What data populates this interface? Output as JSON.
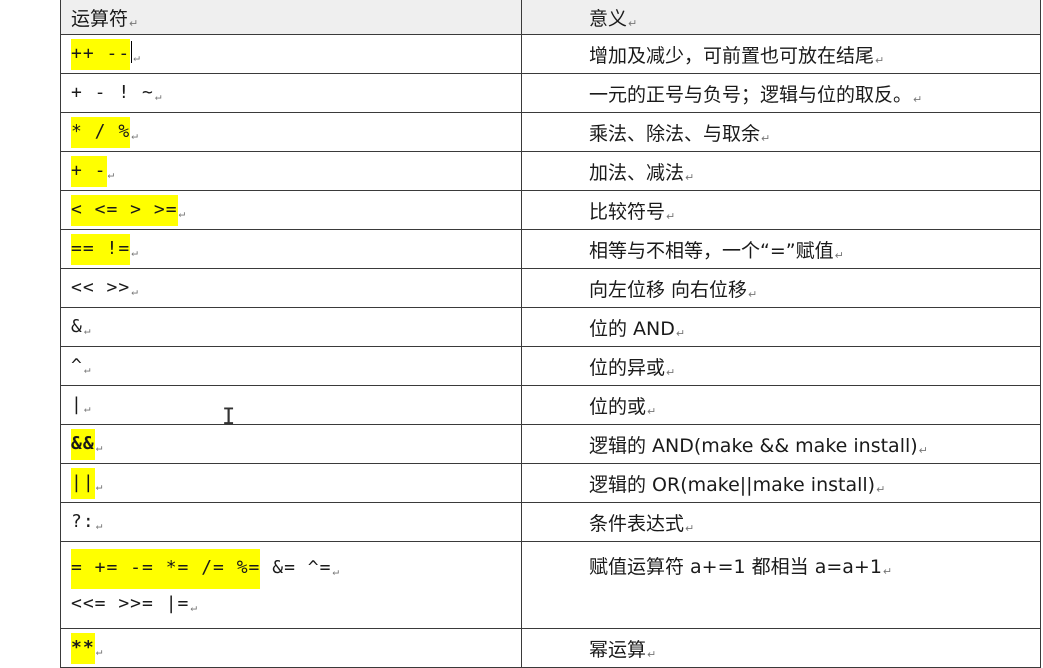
{
  "header": {
    "operator": "运算符",
    "meaning": "意义"
  },
  "paragraph_mark": "↵",
  "rows": [
    {
      "op": "++ --",
      "meaning": "增加及减少，可前置也可放在结尾",
      "highlight": true,
      "bold": false
    },
    {
      "op": "+ - ! ~",
      "meaning": "一元的正号与负号；逻辑与位的取反。",
      "highlight": false,
      "bold": false
    },
    {
      "op": "* / %",
      "meaning": "乘法、除法、与取余",
      "highlight": true,
      "bold": false
    },
    {
      "op": "+ -",
      "meaning": "加法、减法",
      "highlight": true,
      "bold": false
    },
    {
      "op": "< <=  >  >=",
      "meaning": "比较符号",
      "highlight": true,
      "bold": false
    },
    {
      "op": "== !=",
      "meaning": "相等与不相等，一个“=”赋值",
      "highlight": true,
      "bold": false
    },
    {
      "op": "<<   >>",
      "meaning": "向左位移  向右位移",
      "highlight": false,
      "bold": false
    },
    {
      "op": "&",
      "meaning": "位的 AND",
      "highlight": false,
      "bold": false
    },
    {
      "op": "^",
      "meaning": "位的异或",
      "highlight": false,
      "bold": false
    },
    {
      "op": "|",
      "meaning": "位的或",
      "highlight": false,
      "bold": false
    },
    {
      "op": "&&",
      "meaning": "逻辑的 AND(make && make install)",
      "highlight": true,
      "bold": true
    },
    {
      "op": "||",
      "meaning": "逻辑的 OR(make||make install)",
      "highlight": true,
      "bold": false
    },
    {
      "op": "?:",
      "meaning": "条件表达式",
      "highlight": false,
      "bold": false
    }
  ],
  "assign_row": {
    "op_highlighted": "=  +=  -=  *=  /=  %=",
    "op_rest": "  &=  ^=",
    "op_line2": "<<=    >>=    |=",
    "meaning": "赋值运算符 a+=1  都相当 a=a+1"
  },
  "last_row": {
    "op": "**",
    "meaning": "幂运算"
  },
  "colors": {
    "highlight": "#ffff00",
    "border": "#3a3a3a",
    "header_bg": "#efefef"
  }
}
